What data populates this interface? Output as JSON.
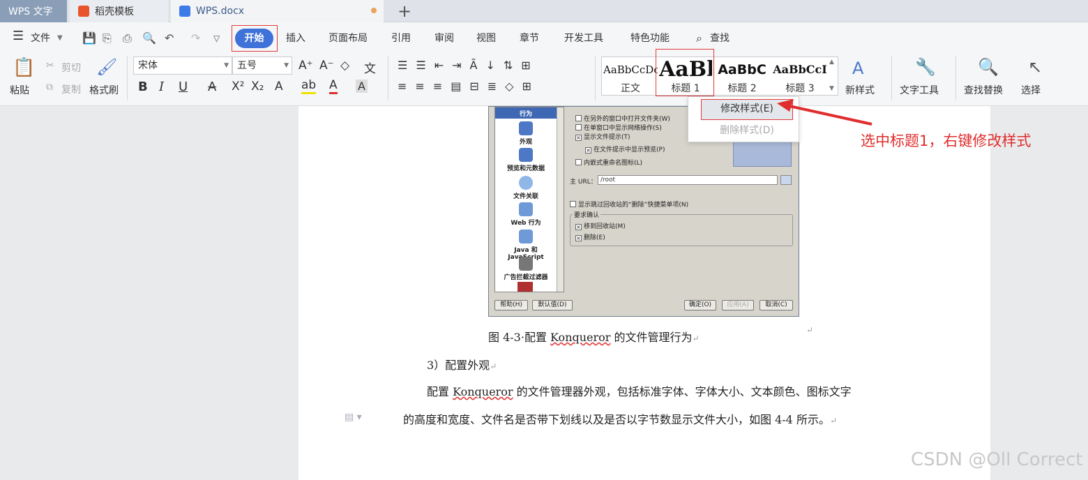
{
  "tabs": [
    {
      "label": "WPS 文字"
    },
    {
      "label": "稻壳模板"
    },
    {
      "label": "WPS.docx"
    }
  ],
  "menu": {
    "file": "文件",
    "kaishi": "开始",
    "items": [
      "插入",
      "页面布局",
      "引用",
      "审阅",
      "视图",
      "章节",
      "开发工具",
      "特色功能"
    ],
    "search": "查找"
  },
  "ribbon": {
    "paste": "粘贴",
    "cut": "剪切",
    "copy": "复制",
    "format_painter": "格式刷",
    "font": "宋体",
    "size": "五号",
    "styles": [
      {
        "preview": "AaBbCcDc",
        "label": "正文"
      },
      {
        "preview": "AaBl",
        "label": "标题 1"
      },
      {
        "preview": "AaBbC",
        "label": "标题 2"
      },
      {
        "preview": "AaBbCcI",
        "label": "标题 3"
      }
    ],
    "new_style": "新样式",
    "text_tools": "文字工具",
    "find_replace": "查找替换",
    "select": "选择"
  },
  "context_menu": {
    "modify": "修改样式(E)",
    "delete": "删除样式(D)"
  },
  "annotation": "选中标题1，右键修改样式",
  "figure": {
    "nav": [
      "行为",
      "外观",
      "预览和元数据",
      "文件关联",
      "Web 行为",
      "Java 和 JavaScript",
      "广告拦截过滤器"
    ],
    "options": [
      "在另外的窗口中打开文件夹(W)",
      "在单窗口中显示网络操作(S)",
      "显示文件提示(T)",
      "在文件提示中显示预览(P)",
      "内嵌式重命名图标(L)"
    ],
    "url_label": "主 URL：",
    "url_value": "/root",
    "trash_shortcut": "显示跳过回收站的“删除”快捷菜单项(N)",
    "confirm_group": "要求确认",
    "confirm_items": [
      "移到回收站(M)",
      "删除(E)"
    ],
    "buttons": [
      "帮助(H)",
      "默认值(D)",
      "确定(O)",
      "应用(A)",
      "取消(C)"
    ]
  },
  "document": {
    "caption_a": "图 4-3·配置 ",
    "caption_b": "Konqueror",
    "caption_c": " 的文件管理行为",
    "heading": "3）配置外观",
    "para1_a": "配置 ",
    "para1_b": "Konqueror",
    "para1_c": " 的文件管理器外观，包括标准字体、字体大小、文本颜色、图标文字",
    "para2": "的高度和宽度、文件名是否带下划线以及是否以字节数显示文件大小，如图 4-4 所示。"
  },
  "watermark": "CSDN @Oll Correct"
}
